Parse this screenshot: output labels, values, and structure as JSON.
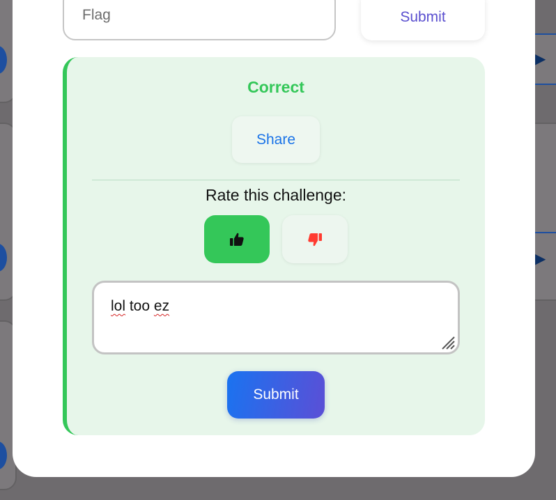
{
  "flag": {
    "placeholder": "Flag",
    "submit_label": "Submit"
  },
  "result": {
    "status": "Correct",
    "share_label": "Share",
    "rate_label": "Rate this challenge:",
    "thumbs_up_icon": "thumbs-up-icon",
    "thumbs_down_icon": "thumbs-down-icon",
    "selected_rating": "thumbs-up",
    "comment_text_parts": [
      "lol",
      " too ",
      "ez"
    ],
    "submit_label": "Submit"
  },
  "colors": {
    "success": "#34c759",
    "danger": "#ff3b30",
    "link": "#1a73e8",
    "accent": "#5a4fcf"
  }
}
